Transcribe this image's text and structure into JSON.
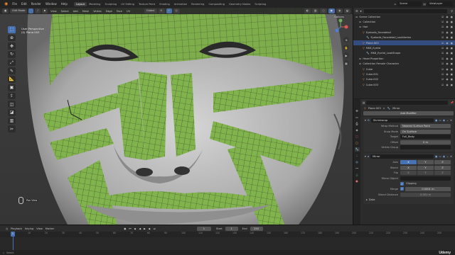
{
  "top_menu": [
    "File",
    "Edit",
    "Render",
    "Window",
    "Help"
  ],
  "workspaces": [
    "Layout",
    "Modeling",
    "Sculpting",
    "UV Editing",
    "Texture Paint",
    "Shading",
    "Animation",
    "Rendering",
    "Compositing",
    "Geometry Nodes",
    "Scripting"
  ],
  "active_workspace": "Layout",
  "scene": {
    "label": "Scene",
    "view_layer": "ViewLayer"
  },
  "viewport_header": {
    "mode": "Edit Mode",
    "menus": [
      "View",
      "Select",
      "Add",
      "Mesh",
      "Vertex",
      "Edge",
      "Face",
      "UV"
    ],
    "orientation": "Global",
    "options": "Options"
  },
  "viewport_info": {
    "line1": "User Perspective",
    "line2": "(0) Plane.003"
  },
  "toolbar_icons": [
    "select-box",
    "cursor",
    "move",
    "rotate",
    "scale",
    "transform",
    "annotate",
    "measure",
    "add-cube",
    "extrude",
    "inset",
    "bevel",
    "loop-cut",
    "knife",
    "poly-build",
    "spin",
    "smooth",
    "edge-slide",
    "shrink-fatten",
    "shear",
    "rip"
  ],
  "mouse_hint": "Pan View",
  "outliner": {
    "header_search": "",
    "rows": [
      {
        "indent": 0,
        "icon": "collection",
        "label": "Scene Collection",
        "sel": false
      },
      {
        "indent": 1,
        "icon": "collection",
        "label": "Collection",
        "sel": false
      },
      {
        "indent": 1,
        "icon": "collection",
        "label": "Hair",
        "sel": false
      },
      {
        "indent": 2,
        "icon": "mesh",
        "label": "Eyeballs_Facedetail",
        "sel": false
      },
      {
        "indent": 3,
        "icon": "modifier",
        "label": "Eyeballs_Facedetail_LookVertex",
        "sel": false
      },
      {
        "indent": 2,
        "icon": "mesh",
        "label": "Plane.003",
        "sel": true
      },
      {
        "indent": 2,
        "icon": "mesh",
        "label": "MK8_Eyelid",
        "sel": false
      },
      {
        "indent": 3,
        "icon": "modifier",
        "label": "MK8_Eyelid_LookShape",
        "sel": false
      },
      {
        "indent": 1,
        "icon": "collection",
        "label": "Head Proportion",
        "sel": false
      },
      {
        "indent": 1,
        "icon": "collection",
        "label": "Collection Female Character",
        "sel": false
      },
      {
        "indent": 2,
        "icon": "mesh",
        "label": "Cube",
        "sel": false
      },
      {
        "indent": 2,
        "icon": "mesh",
        "label": "Cube.001",
        "sel": false
      },
      {
        "indent": 2,
        "icon": "mesh",
        "label": "Cube.002",
        "sel": false
      },
      {
        "indent": 2,
        "icon": "mesh",
        "label": "Cube.003",
        "sel": false
      }
    ]
  },
  "properties": {
    "object_name": "Plane.003",
    "breadcrumb_sep": ">",
    "tab_label": "Mirror",
    "add_modifier": "Add Modifier",
    "shrinkwrap": {
      "name": "Shrinkwrap",
      "wrap_method_label": "Wrap Method",
      "wrap_method": "Nearest Surface Point",
      "snap_mode_label": "Snap Mode",
      "snap_mode": "On Surface",
      "target_label": "Target",
      "target": "Full_Body",
      "offset_label": "Offset",
      "offset": "0 m",
      "vgroup_label": "Vertex Group",
      "vgroup": ""
    },
    "mirror": {
      "name": "Mirror",
      "axis_label": "Axis",
      "bisect_label": "Bisect",
      "flip_label": "Flip",
      "axes": [
        "X",
        "Y",
        "Z"
      ],
      "mirror_object_label": "Mirror Object",
      "mirror_object": "",
      "clipping_label": "Clipping",
      "merge_label": "Merge",
      "merge": "0.0001 m",
      "bisect_distance_label": "Bisect Distance",
      "bisect_distance": "0.001 m",
      "data_label": "Data"
    }
  },
  "timeline": {
    "menus": [
      "Playback",
      "Keying",
      "View",
      "Marker"
    ],
    "ticks": [
      "0",
      "10",
      "20",
      "30",
      "40",
      "50",
      "60",
      "70",
      "80",
      "90",
      "100",
      "110",
      "120",
      "130",
      "140",
      "150",
      "160",
      "170",
      "180",
      "190",
      "200",
      "210",
      "220",
      "230",
      "240",
      "250"
    ],
    "current_frame": "1",
    "start_label": "Start",
    "start": "1",
    "end_label": "End",
    "end": "250"
  },
  "status_bar": {
    "left": "Select",
    "right": "Udemy"
  },
  "colors": {
    "accent": "#4772b3",
    "mesh_green": "#7fb04a",
    "skin": "#c9c9c9"
  }
}
